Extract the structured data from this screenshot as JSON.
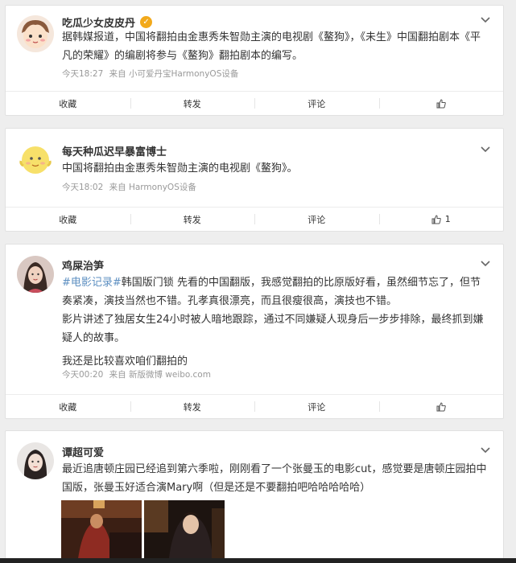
{
  "posts": [
    {
      "user": "吃瓜少女皮皮丹",
      "verified": true,
      "paragraphs": [
        "据韩媒报道，中国将翻拍由金惠秀朱智勋主演的电视剧《鳌狗》，《未生》中国翻拍剧本《平凡的荣耀》的编剧将参与《鳌狗》翻拍剧本的编写。"
      ],
      "time": "今天18:27",
      "source": "来自 小可爱丹宝HarmonyOS设备",
      "actions": {
        "collect": "收藏",
        "repost": "转发",
        "comment": "评论",
        "likes": ""
      }
    },
    {
      "user": "每天种瓜迟早暴富博士",
      "paragraphs": [
        "中国将翻拍由金惠秀朱智勋主演的电视剧《鳌狗》。"
      ],
      "time": "今天18:02",
      "source": "来自 HarmonyOS设备",
      "actions": {
        "collect": "收藏",
        "repost": "转发",
        "comment": "评论",
        "likes": "1"
      }
    },
    {
      "user": "鸡屎治笋",
      "hashtag1": "#电影记录#",
      "hashtag2": "韩国版门锁",
      "p1_rest": " 先看的中国翻版，我感觉翻拍的比原版好看，虽然细节忘了，但节奏紧凑，演技当然也不错。孔孝真很漂亮，而且很瘦很高，演技也不错。",
      "p2": "影片讲述了独居女生24小时被人暗地跟踪，通过不同嫌疑人现身后一步步排除，最终抓到嫌疑人的故事。",
      "p3": "我还是比较喜欢咱们翻拍的",
      "time": "今天00:20",
      "source": "来自 新版微博 weibo.com",
      "actions": {
        "collect": "收藏",
        "repost": "转发",
        "comment": "评论",
        "likes": ""
      }
    },
    {
      "user": "谭超可爱",
      "paragraphs": [
        "最近追唐顿庄园已经追到第六季啦，刚刚看了一个张曼玉的电影cut，感觉要是唐顿庄园拍中国版，张曼玉好适合演Mary啊（但是还是不要翻拍吧哈哈哈哈哈）"
      ]
    }
  ],
  "colors": {
    "hashtag": "#eb7350",
    "verified": "#f2a91b",
    "meta": "#999999"
  }
}
